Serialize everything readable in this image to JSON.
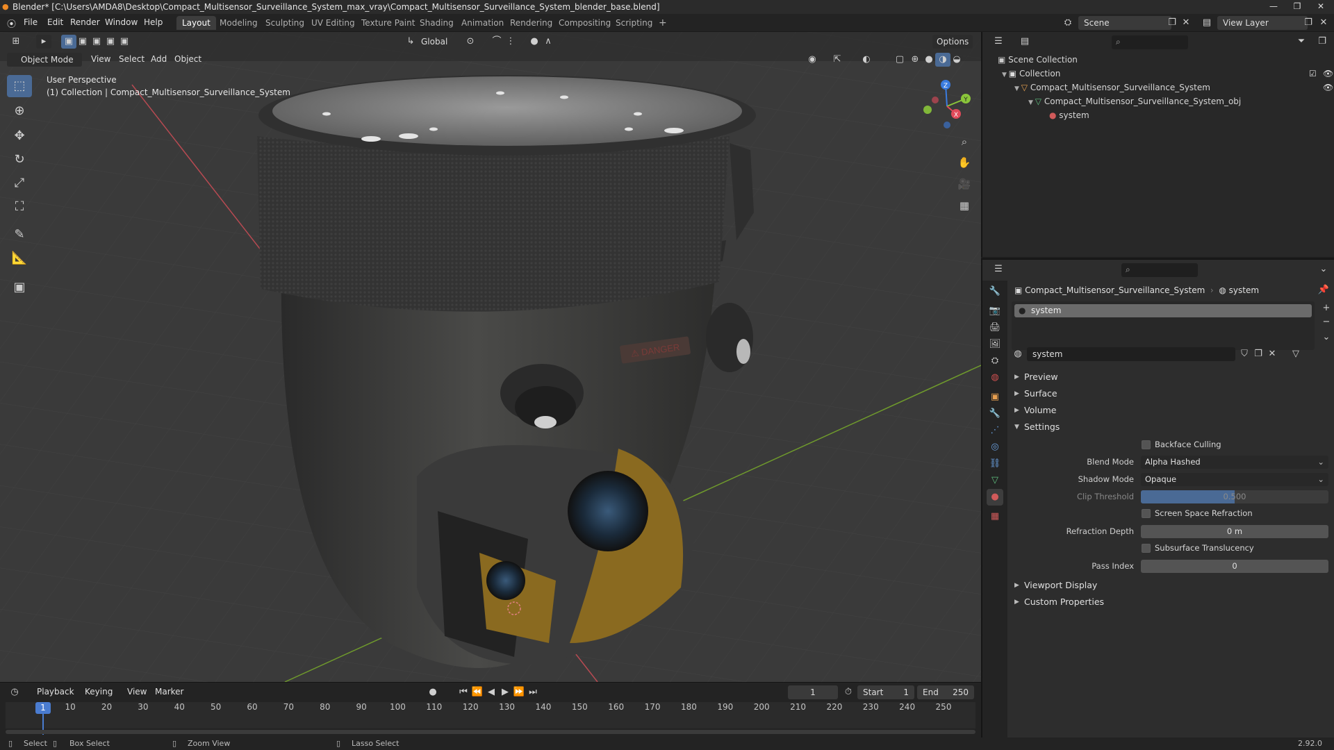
{
  "titlebar": {
    "title": "Blender* [C:\\Users\\AMDA8\\Desktop\\Compact_Multisensor_Surveillance_System_max_vray\\Compact_Multisensor_Surveillance_System_blender_base.blend]",
    "minimize": "—",
    "maximize": "❐",
    "close": "✕"
  },
  "topbar": {
    "menus": [
      "File",
      "Edit",
      "Render",
      "Window",
      "Help"
    ],
    "workspaces": [
      "Layout",
      "Modeling",
      "Sculpting",
      "UV Editing",
      "Texture Paint",
      "Shading",
      "Animation",
      "Rendering",
      "Compositing",
      "Scripting"
    ],
    "add_workspace": "+",
    "scene": "Scene",
    "view_layer": "View Layer"
  },
  "viewport": {
    "transform_orientation": "Global",
    "options_label": "Options",
    "mode": "Object Mode",
    "menus": [
      "View",
      "Select",
      "Add",
      "Object"
    ],
    "overlay_text_1": "User Perspective",
    "overlay_text_2": "(1) Collection | Compact_Multisensor_Surveillance_System",
    "gizmo_axes": [
      "Z",
      "Y",
      "X"
    ],
    "model_decal": "⚠ DANGER"
  },
  "outliner": {
    "search_placeholder": "",
    "rows": [
      "Scene Collection",
      "Collection",
      "Compact_Multisensor_Surveillance_System",
      "Compact_Multisensor_Surveillance_System_obj",
      "system"
    ]
  },
  "properties": {
    "object_name": "Compact_Multisensor_Surveillance_System",
    "material_name": "system",
    "slot_name": "system",
    "material_field": "system",
    "panels": [
      "Preview",
      "Surface",
      "Volume",
      "Settings",
      "Viewport Display",
      "Custom Properties"
    ],
    "settings": {
      "backface_culling": "Backface Culling",
      "blend_mode_label": "Blend Mode",
      "blend_mode_value": "Alpha Hashed",
      "shadow_mode_label": "Shadow Mode",
      "shadow_mode_value": "Opaque",
      "clip_threshold_label": "Clip Threshold",
      "clip_threshold_value": "0.500",
      "ssr_label": "Screen Space Refraction",
      "refraction_depth_label": "Refraction Depth",
      "refraction_depth_value": "0 m",
      "subsurface_label": "Subsurface Translucency",
      "pass_index_label": "Pass Index",
      "pass_index_value": "0"
    }
  },
  "timeline": {
    "menus": [
      "Playback",
      "Keying",
      "View",
      "Marker"
    ],
    "current_frame": "1",
    "start_label": "Start",
    "start_value": "1",
    "end_label": "End",
    "end_value": "250",
    "ticks": [
      "1",
      "10",
      "20",
      "30",
      "40",
      "50",
      "60",
      "70",
      "80",
      "90",
      "100",
      "110",
      "120",
      "130",
      "140",
      "150",
      "160",
      "170",
      "180",
      "190",
      "200",
      "210",
      "220",
      "230",
      "240",
      "250"
    ]
  },
  "statusbar": {
    "select": "Select",
    "box_select": "Box Select",
    "zoom_view": "Zoom View",
    "lasso_select": "Lasso Select",
    "version": "2.92.0"
  },
  "colors": {
    "accent": "#4a6a95",
    "viewport_bg": "#3a3a3a",
    "x_axis": "#e04a5a",
    "y_axis": "#8ac53a",
    "z_axis": "#3a7ce0"
  }
}
